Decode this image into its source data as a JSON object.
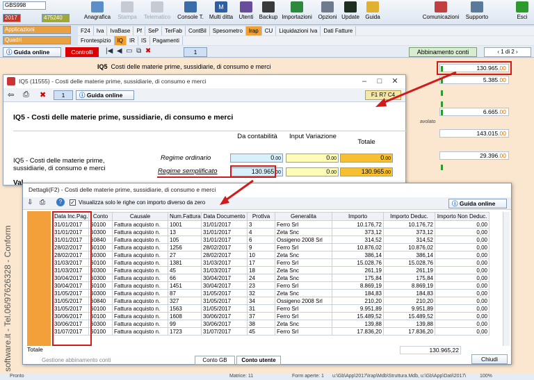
{
  "toolbar": {
    "dropdowns": [
      "GBS998",
      "2017",
      "475240",
      "Applicazioni",
      "Quadri"
    ],
    "buttons": [
      "Anagrafica",
      "Stampa",
      "Telematico",
      "Console T.",
      "Multi ditta",
      "Utenti",
      "Backup",
      "Importazioni",
      "Opzioni",
      "Update",
      "Guida",
      "Comunicazioni",
      "Supporto",
      "Esci"
    ],
    "tabs_row1": [
      "F24",
      "Iva",
      "IvaBase",
      "Pf",
      "SeP",
      "TerFab",
      "ContBil",
      "Spesometro",
      "Irap",
      "CU",
      "Liquidazioni Iva",
      "Dati Fatture"
    ],
    "tabs_row2": [
      "Frontespizio",
      "IQ",
      "IR",
      "IS",
      "Pagamenti"
    ]
  },
  "nav": {
    "guida": "Guida online",
    "controlli": "Controlli",
    "page": "1",
    "abbinamento": "Abbinamento conti",
    "page_of": "1 di 2"
  },
  "bgform": {
    "section": "IQ5",
    "title": "Costi delle materie prime, sussidiarie, di consumo e merci",
    "v1": "130.965",
    "v1dec": ",00",
    "v2": "5.385",
    "v2dec": ".00",
    "v3": "6.665",
    "v3dec": ".00",
    "v4": "143.015",
    "v4dec": ".00",
    "v5": "29.396",
    "v5dec": ".00",
    "lbl_mark": "3",
    "lbl_vol": "avolato",
    "side_text": "software.it - Tel.06/97626328 - Conform",
    "gestione": "Gestione abbinamento conti",
    "conto_gb": "Conto GB",
    "conto_utente": "Conto utente",
    "chiudi": "Chiudi"
  },
  "dlg1": {
    "title": "IQ5 (11555) - Costi delle materie prime, sussidiarie, di consumo e merci",
    "page": "1",
    "guida": "Guida online",
    "code": "F1 R7 C4",
    "heading": "IQ5 - Costi delle materie prime, sussidiarie, di consumo e merci",
    "col_headers": [
      "Da contabilità",
      "Input Variazione",
      "Totale"
    ],
    "rowlabel": "IQ5 - Costi delle materie prime, sussidiarie, di consumo e merci",
    "regime_ord": "Regime ordinario",
    "regime_sem": "Regime semplificato",
    "ord_vals": [
      "0",
      "0",
      "0"
    ],
    "sem_vals": [
      "130.965",
      "0",
      "130.965"
    ],
    "dec": ".00",
    "val_label": "Val"
  },
  "dlg2": {
    "title": "Dettagli(F2) - Costi delle materie prime, sussidiarie, di consumo e merci",
    "checkbox_label": "Visualizza solo le righe con importo diverso da zero",
    "guida": "Guida online",
    "columns": [
      "Data Inc.Pag.",
      "Conto",
      "Causale",
      "Num.Fattura",
      "Data Documento",
      "ProtIva",
      "Generalita",
      "Importo",
      "Importo Deduc.",
      "Importo Non Deduc."
    ],
    "rows": [
      [
        "31/01/2017",
        "60100",
        "Fattura acquisto n.",
        "1001",
        "31/01/2017",
        "3",
        "Ferro Srl",
        "10.176,72",
        "10.176,72",
        "0,00"
      ],
      [
        "31/01/2017",
        "60300",
        "Fattura acquisto n.",
        "13",
        "31/01/2017",
        "4",
        "Zeta Snc",
        "373,12",
        "373,12",
        "0,00"
      ],
      [
        "31/01/2017",
        "60840",
        "Fattura acquisto n.",
        "105",
        "31/01/2017",
        "6",
        "Ossigeno 2008 Srl",
        "314,52",
        "314,52",
        "0,00"
      ],
      [
        "28/02/2017",
        "60100",
        "Fattura acquisto n.",
        "1256",
        "28/02/2017",
        "9",
        "Ferro Srl",
        "10.876,02",
        "10.876,02",
        "0,00"
      ],
      [
        "28/02/2017",
        "60300",
        "Fattura acquisto n.",
        "27",
        "28/02/2017",
        "10",
        "Zeta Snc",
        "386,14",
        "386,14",
        "0,00"
      ],
      [
        "31/03/2017",
        "60100",
        "Fattura acquisto n.",
        "1381",
        "31/03/2017",
        "17",
        "Ferro Srl",
        "15.028,76",
        "15.028,76",
        "0,00"
      ],
      [
        "31/03/2017",
        "60300",
        "Fattura acquisto n.",
        "45",
        "31/03/2017",
        "18",
        "Zeta Snc",
        "261,19",
        "261,19",
        "0,00"
      ],
      [
        "30/04/2017",
        "60300",
        "Fattura acquisto n.",
        "66",
        "30/04/2017",
        "24",
        "Zeta Snc",
        "175,84",
        "175,84",
        "0,00"
      ],
      [
        "30/04/2017",
        "60100",
        "Fattura acquisto n.",
        "1451",
        "30/04/2017",
        "23",
        "Ferro Srl",
        "8.869,19",
        "8.869,19",
        "0,00"
      ],
      [
        "31/05/2017",
        "60300",
        "Fattura acquisto n.",
        "87",
        "31/05/2017",
        "32",
        "Zeta Snc",
        "184,83",
        "184,83",
        "0,00"
      ],
      [
        "31/05/2017",
        "60840",
        "Fattura acquisto n.",
        "327",
        "31/05/2017",
        "34",
        "Ossigeno 2008 Srl",
        "210,20",
        "210,20",
        "0,00"
      ],
      [
        "31/05/2017",
        "60100",
        "Fattura acquisto n.",
        "1563",
        "31/05/2017",
        "31",
        "Ferro Srl",
        "9.951,89",
        "9.951,89",
        "0,00"
      ],
      [
        "30/06/2017",
        "60100",
        "Fattura acquisto n.",
        "1608",
        "30/06/2017",
        "37",
        "Ferro Srl",
        "15.489,52",
        "15.489,52",
        "0,00"
      ],
      [
        "30/06/2017",
        "60300",
        "Fattura acquisto n.",
        "99",
        "30/06/2017",
        "38",
        "Zeta Snc",
        "139,88",
        "139,88",
        "0,00"
      ],
      [
        "31/07/2017",
        "60100",
        "Fattura acquisto n.",
        "1723",
        "31/07/2017",
        "45",
        "Ferro Srl",
        "17.836,20",
        "17.836,20",
        "0,00"
      ]
    ],
    "totale_label": "Totale",
    "totale_value": "130.965,22"
  },
  "status": {
    "left": "Pronto",
    "mid1": "Matrice: 11",
    "mid2": "Form aperte: 1",
    "path": "u:\\Gb\\App\\2017\\Irap\\Mdb\\Struttura.Mdb, u:\\Gb\\App\\Dati\\2017\\",
    "zoom": "100%"
  }
}
